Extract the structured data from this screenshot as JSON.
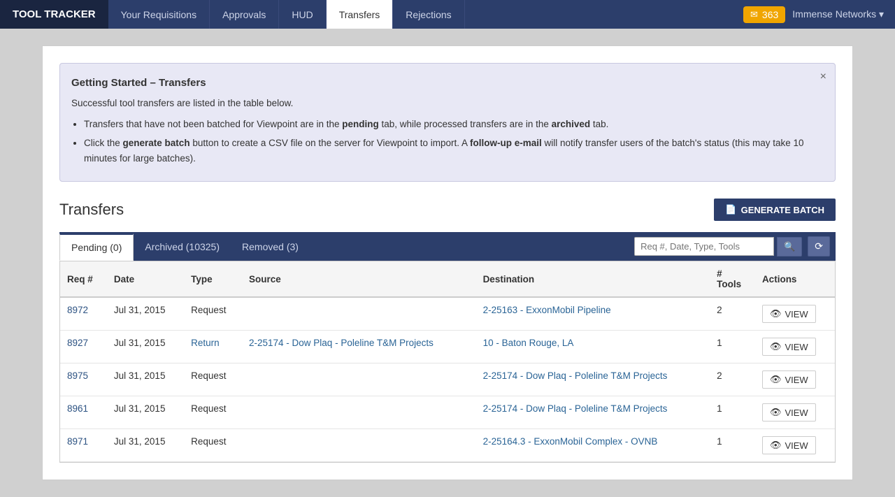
{
  "brand": "TOOL TRACKER",
  "nav": {
    "links": [
      {
        "label": "Your Requisitions",
        "active": false
      },
      {
        "label": "Approvals",
        "active": false
      },
      {
        "label": "HUD",
        "active": false
      },
      {
        "label": "Transfers",
        "active": true
      },
      {
        "label": "Rejections",
        "active": false
      }
    ],
    "badge_icon": "✉",
    "badge_count": "363",
    "user_label": "Immense Networks",
    "user_caret": "▾"
  },
  "alert": {
    "title": "Getting Started – Transfers",
    "subtitle": "Successful tool transfers are listed in the table below.",
    "bullets": [
      "Transfers that have not been batched for Viewpoint are in the pending tab, while processed transfers are in the archived tab.",
      "Click the generate batch button to create a CSV file on the server for Viewpoint to import. A follow-up e-mail will notify transfer users of the batch's status (this may take 10 minutes for large batches)."
    ],
    "bold_terms": [
      "pending",
      "archived",
      "generate batch",
      "follow-up e-mail"
    ]
  },
  "page": {
    "title": "Transfers",
    "generate_batch_label": "GENERATE BATCH",
    "generate_icon": "📄"
  },
  "tabs": [
    {
      "label": "Pending (0)",
      "active": true
    },
    {
      "label": "Archived (10325)",
      "active": false
    },
    {
      "label": "Removed (3)",
      "active": false
    }
  ],
  "search": {
    "placeholder": "Req #, Date, Type, Tools",
    "search_icon": "🔍",
    "refresh_icon": "⟳"
  },
  "table": {
    "columns": [
      "Req #",
      "Date",
      "Type",
      "Source",
      "Destination",
      "# Tools",
      "Actions"
    ],
    "rows": [
      {
        "req": "8972",
        "date": "Jul 31, 2015",
        "type": "Request",
        "source": "",
        "destination": "2-25163 - ExxonMobil Pipeline",
        "tools": "2",
        "type_class": ""
      },
      {
        "req": "8927",
        "date": "Jul 31, 2015",
        "type": "Return",
        "source": "2-25174 - Dow Plaq - Poleline T&M Projects",
        "destination": "10 - Baton Rouge, LA",
        "tools": "1",
        "type_class": "return"
      },
      {
        "req": "8975",
        "date": "Jul 31, 2015",
        "type": "Request",
        "source": "",
        "destination": "2-25174 - Dow Plaq - Poleline T&M Projects",
        "tools": "2",
        "type_class": ""
      },
      {
        "req": "8961",
        "date": "Jul 31, 2015",
        "type": "Request",
        "source": "",
        "destination": "2-25174 - Dow Plaq - Poleline T&M Projects",
        "tools": "1",
        "type_class": ""
      },
      {
        "req": "8971",
        "date": "Jul 31, 2015",
        "type": "Request",
        "source": "",
        "destination": "2-25164.3 - ExxonMobil Complex - OVNB",
        "tools": "1",
        "type_class": ""
      }
    ],
    "view_label": "VIEW"
  }
}
